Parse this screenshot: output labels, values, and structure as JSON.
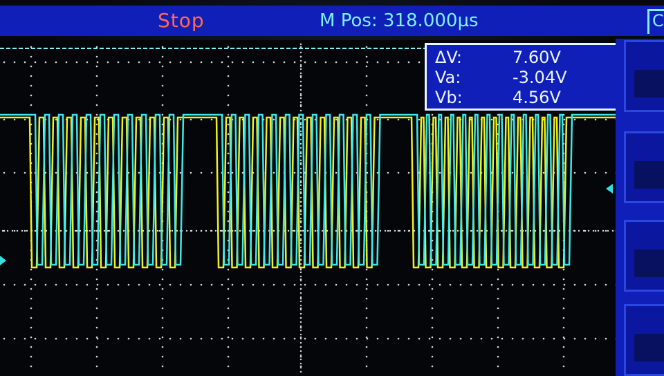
{
  "header": {
    "run_status": "Stop",
    "main_position": "M Pos: 318.000µs",
    "edge_menu_label": "C"
  },
  "measurement": {
    "rows": [
      {
        "label": "ΔV:",
        "value": "7.60V"
      },
      {
        "label": "Va:",
        "value": "-3.04V"
      },
      {
        "label": "Vb:",
        "value": "4.56V"
      }
    ]
  },
  "colors": {
    "channel1": "#f0f020",
    "channel2": "#3de8e8",
    "panel_blue": "#0f1fb8",
    "status_red": "#ff6a5a",
    "grid": "#d8d8d8"
  },
  "icons": {
    "trigger_marker": "triangle-right",
    "level_marker": "triangle-left"
  }
}
